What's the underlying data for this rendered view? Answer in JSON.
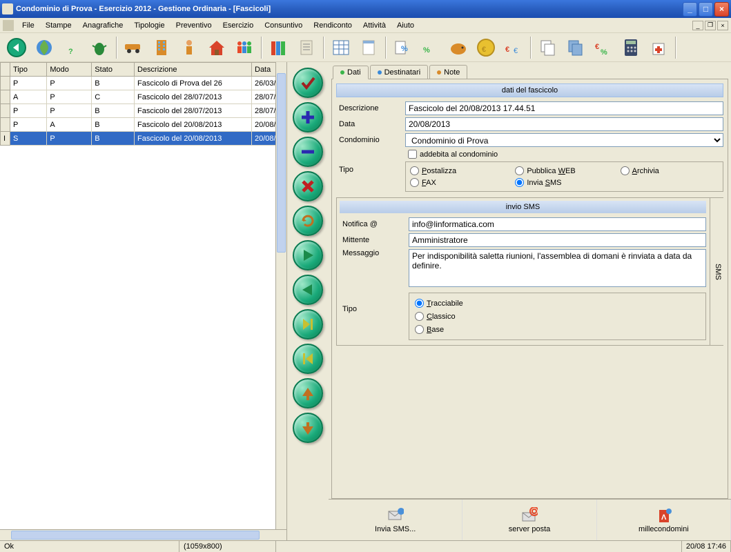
{
  "window": {
    "title": "Condominio di Prova - Esercizio 2012 - Gestione Ordinaria - [Fascicoli]"
  },
  "menu": {
    "items": [
      "File",
      "Stampe",
      "Anagrafiche",
      "Tipologie",
      "Preventivo",
      "Esercizio",
      "Consuntivo",
      "Rendiconto",
      "Attività",
      "Aiuto"
    ]
  },
  "grid": {
    "headers": [
      "Tipo",
      "Modo",
      "Stato",
      "Descrizione",
      "Data"
    ],
    "rows": [
      {
        "tipo": "P",
        "modo": "P",
        "stato": "B",
        "descrizione": "Fascicolo di Prova del 26",
        "data": "26/03/",
        "sel": false
      },
      {
        "tipo": "A",
        "modo": "P",
        "stato": "C",
        "descrizione": "Fascicolo del 28/07/2013",
        "data": "28/07/",
        "sel": false
      },
      {
        "tipo": "P",
        "modo": "P",
        "stato": "B",
        "descrizione": "Fascicolo del 28/07/2013",
        "data": "28/07/",
        "sel": false
      },
      {
        "tipo": "P",
        "modo": "A",
        "stato": "B",
        "descrizione": "Fascicolo del 20/08/2013",
        "data": "20/08/",
        "sel": false
      },
      {
        "tipo": "S",
        "modo": "P",
        "stato": "B",
        "descrizione": "Fascicolo del 20/08/2013",
        "data": "20/08/",
        "sel": true
      }
    ]
  },
  "tabs": {
    "dati": "Dati",
    "destinatari": "Destinatari",
    "note": "Note"
  },
  "form": {
    "section1_title": "dati del fascicolo",
    "descrizione_label": "Descrizione",
    "descrizione_value": "Fascicolo del 20/08/2013 17.44.51",
    "data_label": "Data",
    "data_value": "20/08/2013",
    "condominio_label": "Condominio",
    "condominio_value": "Condominio di Prova",
    "addebita_label": "addebita al condominio",
    "tipo_label": "Tipo",
    "tipo_options": {
      "postalizza": "Postalizza",
      "fax": "FAX",
      "pubblica_web": "Pubblica WEB",
      "invia_sms": "Invia SMS",
      "archivia": "Archivia"
    },
    "section2_title": "invio SMS",
    "sms_side_label": "SMS",
    "notifica_label": "Notifica @",
    "notifica_value": "info@linformatica.com",
    "mittente_label": "Mittente",
    "mittente_value": "Amministratore",
    "messaggio_label": "Messaggio",
    "messaggio_value": "Per indisponibilità saletta riunioni, l'assemblea di domani è rinviata a data da definire.",
    "sms_tipo_label": "Tipo",
    "sms_tipo_options": {
      "tracciabile": "Tracciabile",
      "classico": "Classico",
      "base": "Base"
    }
  },
  "bottom_buttons": {
    "invia_sms": "Invia SMS...",
    "server_posta": "server posta",
    "millecondomini": "millecondomini"
  },
  "statusbar": {
    "ok": "Ok",
    "dims": "(1059x800)",
    "datetime": "20/08 17:46"
  }
}
